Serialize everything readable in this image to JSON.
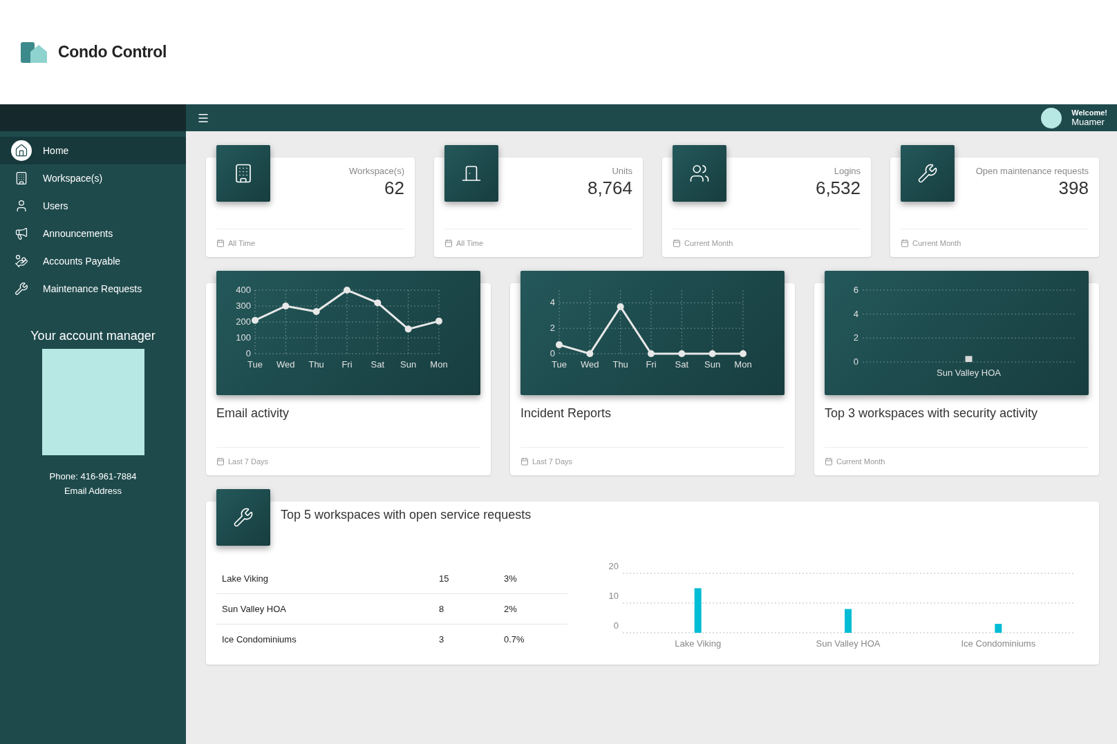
{
  "brand": {
    "name": "Condo Control"
  },
  "topbar": {
    "welcome": "Welcome!",
    "user": "Muamer"
  },
  "sidebar": {
    "items": [
      {
        "label": "Home",
        "selected": true
      },
      {
        "label": "Workspace(s)",
        "selected": false
      },
      {
        "label": "Users",
        "selected": false
      },
      {
        "label": "Announcements",
        "selected": false
      },
      {
        "label": "Accounts Payable",
        "selected": false
      },
      {
        "label": "Maintenance Requests",
        "selected": false
      }
    ],
    "account_manager": {
      "title": "Your account manager",
      "phone": "Phone: 416-961-7884",
      "email": "Email Address"
    }
  },
  "stats": [
    {
      "label": "Workspace(s)",
      "value": "62",
      "period": "All Time"
    },
    {
      "label": "Units",
      "value": "8,764",
      "period": "All Time"
    },
    {
      "label": "Logins",
      "value": "6,532",
      "period": "Current Month"
    },
    {
      "label": "Open maintenance requests",
      "value": "398",
      "period": "Current Month"
    }
  ],
  "charts": [
    {
      "title": "Email activity",
      "period": "Last 7 Days",
      "chart_data": {
        "type": "line",
        "grid": true,
        "categories": [
          "Tue",
          "Wed",
          "Thu",
          "Fri",
          "Sat",
          "Sun",
          "Mon"
        ],
        "series": [
          {
            "color": "#e8e8e8",
            "marker": true,
            "values": [
              210,
              300,
              265,
              400,
              320,
              155,
              205
            ]
          }
        ],
        "ylim": [
          0,
          400
        ],
        "yticks": [
          0,
          100,
          200,
          300,
          400
        ]
      }
    },
    {
      "title": "Incident Reports",
      "period": "Last 7 Days",
      "chart_data": {
        "type": "line",
        "grid": true,
        "categories": [
          "Tue",
          "Wed",
          "Thu",
          "Fri",
          "Sat",
          "Sun",
          "Mon"
        ],
        "series": [
          {
            "color": "#e8e8e8",
            "marker": true,
            "values": [
              0.7,
              0,
              3.7,
              0,
              0,
              0,
              0
            ]
          }
        ],
        "ylim": [
          0,
          5
        ],
        "yticks": [
          0,
          2,
          4
        ]
      }
    },
    {
      "title": "Top 3 workspaces with security activity",
      "period": "Current Month",
      "chart_data": {
        "type": "bar",
        "grid": true,
        "categories": [
          "Sun Valley HOA"
        ],
        "series": [
          {
            "color": "#d9d9d9",
            "values": [
              0.5
            ]
          }
        ],
        "ylim": [
          0,
          6
        ],
        "yticks": [
          0,
          2,
          4,
          6
        ]
      }
    }
  ],
  "service_requests": {
    "title": "Top 5 workspaces with open service requests",
    "rows": [
      {
        "name": "Lake Viking",
        "count": "15",
        "percent": "3%"
      },
      {
        "name": "Sun Valley HOA",
        "count": "8",
        "percent": "2%"
      },
      {
        "name": "Ice Condominiums",
        "count": "3",
        "percent": "0.7%"
      }
    ],
    "chart_data": {
      "type": "bar",
      "grid": true,
      "categories": [
        "Lake Viking",
        "Sun Valley HOA",
        "Ice Condominiums"
      ],
      "series": [
        {
          "color": "#00bcd4",
          "values": [
            15,
            8,
            3
          ]
        }
      ],
      "ylim": [
        0,
        20
      ],
      "yticks": [
        0,
        10,
        20
      ]
    }
  }
}
